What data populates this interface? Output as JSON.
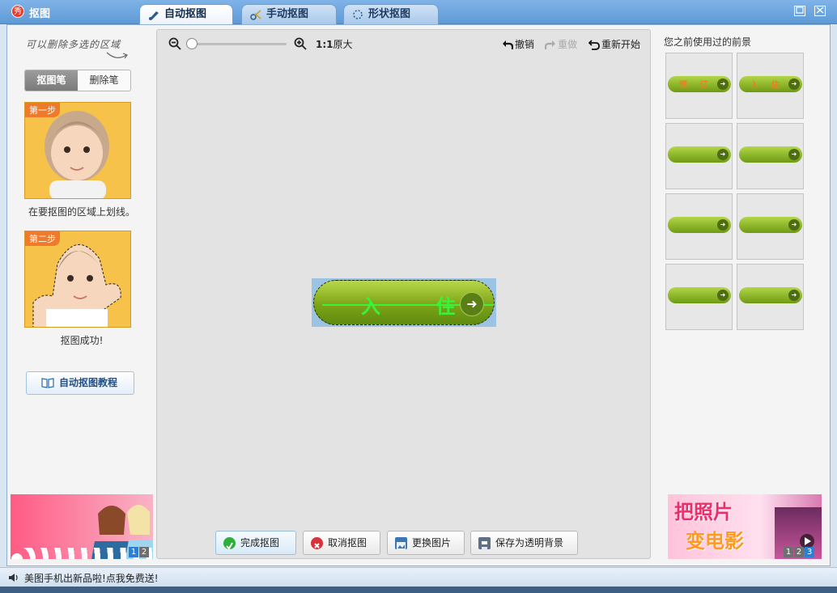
{
  "window": {
    "title": "抠图",
    "app_icon": "秀"
  },
  "tabs": [
    {
      "label": "自动抠图",
      "icon": "brush-icon",
      "active": true
    },
    {
      "label": "手动抠图",
      "icon": "scissors-icon",
      "active": false
    },
    {
      "label": "形状抠图",
      "icon": "shape-icon",
      "active": false
    }
  ],
  "left": {
    "hint": "可以删除多选的区域",
    "pens": [
      {
        "label": "抠图笔",
        "active": true
      },
      {
        "label": "删除笔",
        "active": false
      }
    ],
    "step1_badge": "第一步",
    "step1_caption": "在要抠图的区域上划线。",
    "step2_badge": "第二步",
    "step2_caption": "抠图成功!",
    "tutorial_label": "自动抠图教程",
    "ad_pages": [
      "1",
      "2"
    ]
  },
  "toolbar": {
    "zoom_ratio": "1:1",
    "original_label": "原大",
    "undo_label": "撤销",
    "redo_label": "重做",
    "restart_label": "重新开始"
  },
  "canvas": {
    "button_text": "入 住"
  },
  "actions": {
    "finish_label": "完成抠图",
    "cancel_label": "取消抠图",
    "replace_label": "更换图片",
    "save_label": "保存为透明背景"
  },
  "right": {
    "title": "您之前使用过的前景",
    "thumbs": [
      "预 订",
      "入 住",
      "",
      "",
      "",
      "",
      "",
      ""
    ],
    "ad_line1": "把照片",
    "ad_line2": "变电影",
    "ad_pages": [
      "1",
      "2",
      "3"
    ]
  },
  "status": {
    "text": "美图手机出新品啦!点我免费送!"
  },
  "colors": {
    "accent": "#5f9ad6",
    "button_green": "#7ea417",
    "selection_blue": "#9ac3e4"
  }
}
